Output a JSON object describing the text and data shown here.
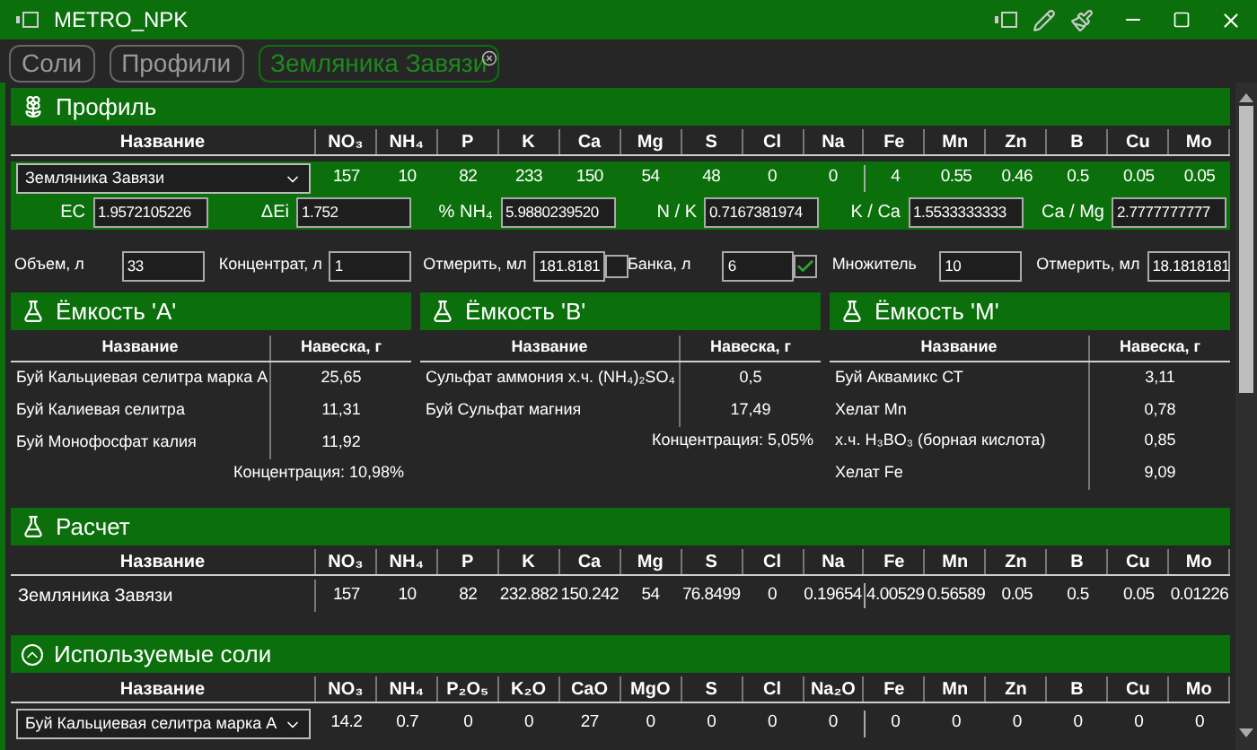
{
  "window": {
    "title": "METRO_NPK"
  },
  "tabs": [
    {
      "label": "Соли",
      "selected": false,
      "closable": false
    },
    {
      "label": "Профили",
      "selected": false,
      "closable": false
    },
    {
      "label": "Земляника Завязи",
      "selected": true,
      "closable": true
    }
  ],
  "profile": {
    "title": "Профиль",
    "columns": [
      "Название",
      "NO₃",
      "NH₄",
      "P",
      "K",
      "Ca",
      "Mg",
      "S",
      "Cl",
      "Na",
      "Fe",
      "Mn",
      "Zn",
      "B",
      "Cu",
      "Mo"
    ],
    "row": {
      "name": "Земляника Завязи",
      "values": [
        "157",
        "10",
        "82",
        "233",
        "150",
        "54",
        "48",
        "0",
        "0",
        "4",
        "0.55",
        "0.46",
        "0.5",
        "0.05",
        "0.05"
      ]
    },
    "ratios": [
      {
        "label": "EC",
        "value": "1.9572105226"
      },
      {
        "label": "ΔEi",
        "value": "1.752"
      },
      {
        "label": "% NH₄",
        "value": "5.9880239520"
      },
      {
        "label": "N / K",
        "value": "0.7167381974"
      },
      {
        "label": "K / Ca",
        "value": "1.5533333333"
      },
      {
        "label": "Ca / Mg",
        "value": "2.7777777777"
      }
    ]
  },
  "inputs": [
    {
      "label": "Объем, л",
      "value": "33",
      "kind": "field"
    },
    {
      "label": "Концентрат, л",
      "value": "1",
      "kind": "field"
    },
    {
      "label": "Отмерить, мл",
      "value": "181.8181",
      "kind": "check",
      "checked": false
    },
    {
      "label": "Банка, л",
      "value": "6",
      "kind": "check",
      "checked": true
    },
    {
      "label": "Множитель",
      "value": "10",
      "kind": "field"
    },
    {
      "label": "Отмерить, мл",
      "value": "18.1818181",
      "kind": "field"
    }
  ],
  "tanks": [
    {
      "title": "Ёмкость 'A'",
      "columns": [
        "Название",
        "Навеска, г"
      ],
      "rows": [
        [
          "Буй Кальциевая селитра марка А",
          "25,65"
        ],
        [
          "Буй Калиевая селитра",
          "11,31"
        ],
        [
          "Буй Монофосфат калия",
          "11,92"
        ]
      ],
      "concentration": "Концентрация: 10,98%"
    },
    {
      "title": "Ёмкость 'B'",
      "columns": [
        "Название",
        "Навеска, г"
      ],
      "rows": [
        [
          "Сульфат аммония х.ч. (NH₄)₂SO₄",
          "0,5"
        ],
        [
          "Буй Сульфат магния",
          "17,49"
        ]
      ],
      "concentration": "Концентрация: 5,05%"
    },
    {
      "title": "Ёмкость 'M'",
      "columns": [
        "Название",
        "Навеска, г"
      ],
      "rows": [
        [
          "Буй Аквамикс СТ",
          "3,11"
        ],
        [
          "Хелат Mn",
          "0,78"
        ],
        [
          "х.ч. H₃BO₃ (борная кислота)",
          "0,85"
        ],
        [
          "Хелат Fe",
          "9,09"
        ]
      ]
    }
  ],
  "calc": {
    "title": "Расчет",
    "columns": [
      "Название",
      "NO₃",
      "NH₄",
      "P",
      "K",
      "Ca",
      "Mg",
      "S",
      "Cl",
      "Na",
      "Fe",
      "Mn",
      "Zn",
      "B",
      "Cu",
      "Mo"
    ],
    "row": {
      "name": "Земляника Завязи",
      "values": [
        "157",
        "10",
        "82",
        "232.882",
        "150.242",
        "54",
        "76.8499",
        "0",
        "0.19654",
        "4.00529",
        "0.56589",
        "0.05",
        "0.5",
        "0.05",
        "0.01226"
      ]
    }
  },
  "salts": {
    "title": "Используемые соли",
    "expanded": true,
    "columns": [
      "Название",
      "NO₃",
      "NH₄",
      "P₂O₅",
      "K₂O",
      "CaO",
      "MgO",
      "S",
      "Cl",
      "Na₂O",
      "Fe",
      "Mn",
      "Zn",
      "B",
      "Cu",
      "Mo"
    ],
    "rows": [
      {
        "name": "Буй Кальциевая селитра марка А",
        "values": [
          "14.2",
          "0.7",
          "0",
          "0",
          "27",
          "0",
          "0",
          "0",
          "0",
          "0",
          "0",
          "0",
          "0",
          "0",
          "0"
        ]
      }
    ]
  }
}
